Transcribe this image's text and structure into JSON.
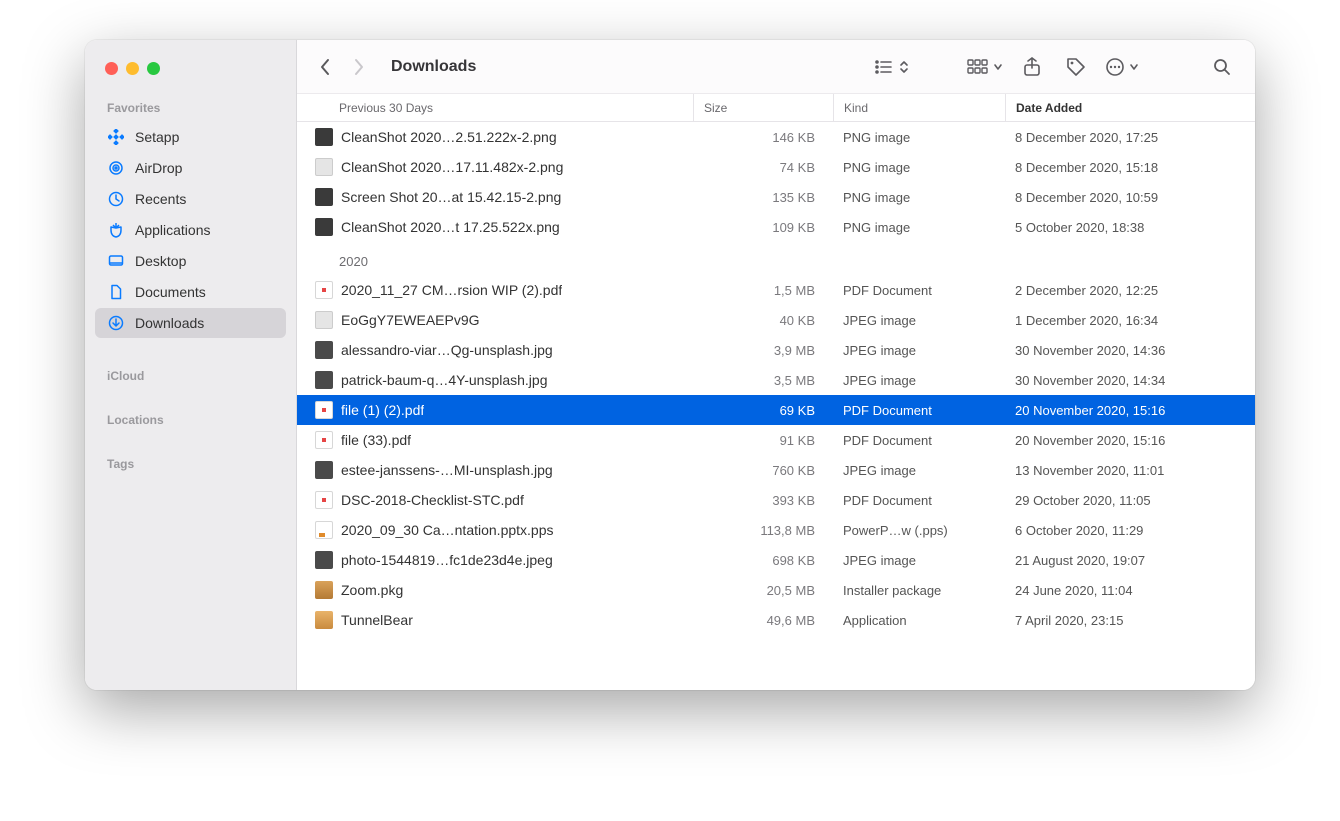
{
  "window_title": "Downloads",
  "sidebar": {
    "sections": [
      {
        "label": "Favorites",
        "items": [
          {
            "icon": "setapp",
            "label": "Setapp",
            "active": false
          },
          {
            "icon": "airdrop",
            "label": "AirDrop",
            "active": false
          },
          {
            "icon": "recents",
            "label": "Recents",
            "active": false
          },
          {
            "icon": "applications",
            "label": "Applications",
            "active": false
          },
          {
            "icon": "desktop",
            "label": "Desktop",
            "active": false
          },
          {
            "icon": "documents",
            "label": "Documents",
            "active": false
          },
          {
            "icon": "downloads",
            "label": "Downloads",
            "active": true
          }
        ]
      },
      {
        "label": "iCloud",
        "items": []
      },
      {
        "label": "Locations",
        "items": []
      },
      {
        "label": "Tags",
        "items": []
      }
    ]
  },
  "columns": {
    "name": "Previous 30 Days",
    "size": "Size",
    "kind": "Kind",
    "date": "Date Added"
  },
  "groups": [
    {
      "label": "",
      "rows": [
        {
          "icon": "img",
          "name": "CleanShot 2020…2.51.222x-2.png",
          "size": "146 KB",
          "kind": "PNG image",
          "date": "8 December 2020, 17:25",
          "selected": false
        },
        {
          "icon": "img-light",
          "name": "CleanShot 2020…17.11.482x-2.png",
          "size": "74 KB",
          "kind": "PNG image",
          "date": "8 December 2020, 15:18",
          "selected": false
        },
        {
          "icon": "img",
          "name": "Screen Shot 20…at 15.42.15-2.png",
          "size": "135 KB",
          "kind": "PNG image",
          "date": "8 December 2020, 10:59",
          "selected": false
        },
        {
          "icon": "img",
          "name": "CleanShot 2020…t 17.25.522x.png",
          "size": "109 KB",
          "kind": "PNG image",
          "date": "5 October 2020, 18:38",
          "selected": false
        }
      ]
    },
    {
      "label": "2020",
      "rows": [
        {
          "icon": "pdf",
          "name": "2020_11_27 CM…rsion WIP (2).pdf",
          "size": "1,5 MB",
          "kind": "PDF Document",
          "date": "2 December 2020, 12:25",
          "selected": false
        },
        {
          "icon": "img-light",
          "name": "EoGgY7EWEAEPv9G",
          "size": "40 KB",
          "kind": "JPEG image",
          "date": "1 December 2020, 16:34",
          "selected": false
        },
        {
          "icon": "jpeg",
          "name": "alessandro-viar…Qg-unsplash.jpg",
          "size": "3,9 MB",
          "kind": "JPEG image",
          "date": "30 November 2020, 14:36",
          "selected": false
        },
        {
          "icon": "jpeg",
          "name": "patrick-baum-q…4Y-unsplash.jpg",
          "size": "3,5 MB",
          "kind": "JPEG image",
          "date": "30 November 2020, 14:34",
          "selected": false
        },
        {
          "icon": "pdf",
          "name": "file (1) (2).pdf",
          "size": "69 KB",
          "kind": "PDF Document",
          "date": "20 November 2020, 15:16",
          "selected": true
        },
        {
          "icon": "pdf",
          "name": "file (33).pdf",
          "size": "91 KB",
          "kind": "PDF Document",
          "date": "20 November 2020, 15:16",
          "selected": false
        },
        {
          "icon": "jpeg",
          "name": "estee-janssens-…MI-unsplash.jpg",
          "size": "760 KB",
          "kind": "JPEG image",
          "date": "13 November 2020, 11:01",
          "selected": false
        },
        {
          "icon": "pdf",
          "name": "DSC-2018-Checklist-STC.pdf",
          "size": "393 KB",
          "kind": "PDF Document",
          "date": "29 October 2020, 11:05",
          "selected": false
        },
        {
          "icon": "pps",
          "name": "2020_09_30 Ca…ntation.pptx.pps",
          "size": "113,8 MB",
          "kind": "PowerP…w (.pps)",
          "date": "6 October 2020, 11:29",
          "selected": false
        },
        {
          "icon": "jpeg",
          "name": "photo-1544819…fc1de23d4e.jpeg",
          "size": "698 KB",
          "kind": "JPEG image",
          "date": "21 August 2020, 19:07",
          "selected": false
        },
        {
          "icon": "pkg",
          "name": "Zoom.pkg",
          "size": "20,5 MB",
          "kind": "Installer package",
          "date": "24 June 2020, 11:04",
          "selected": false
        },
        {
          "icon": "app",
          "name": "TunnelBear",
          "size": "49,6 MB",
          "kind": "Application",
          "date": "7 April 2020, 23:15",
          "selected": false
        }
      ]
    }
  ]
}
